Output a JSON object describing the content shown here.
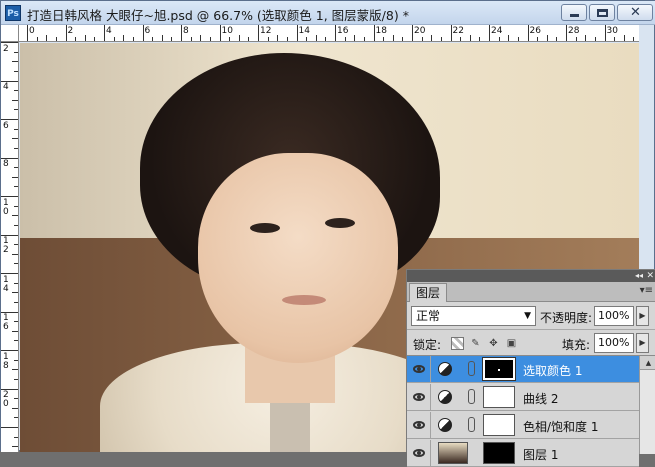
{
  "window": {
    "app_icon": "Ps",
    "title": "打造日韩风格 大眼仔~旭.psd @ 66.7% (选取颜色 1, 图层蒙版/8) *",
    "controls": [
      "minimize-icon",
      "maximize-icon",
      "close-icon"
    ]
  },
  "rulers": {
    "top_labels": [
      "0",
      "2",
      "4",
      "6",
      "8",
      "10",
      "12",
      "14",
      "16",
      "18",
      "20",
      "22",
      "24",
      "26",
      "28",
      "30"
    ],
    "left_labels": [
      "2",
      "4",
      "6",
      "8",
      "1\n0",
      "1\n2",
      "1\n4",
      "1\n6",
      "1\n8",
      "2\n0"
    ]
  },
  "layers_panel": {
    "tab": "图层",
    "blend_mode": "正常",
    "opacity_label": "不透明度:",
    "opacity_value": "100%",
    "lock_label": "锁定:",
    "fill_label": "填充:",
    "fill_value": "100%",
    "layers": [
      {
        "name": "选取颜色 1",
        "type": "adjustment",
        "mask": "black",
        "selected": true,
        "visible": true
      },
      {
        "name": "曲线 2",
        "type": "adjustment",
        "mask": "white",
        "selected": false,
        "visible": true
      },
      {
        "name": "色相/饱和度 1",
        "type": "adjustment",
        "mask": "white",
        "selected": false,
        "visible": true
      },
      {
        "name": "图层 1",
        "type": "pixel",
        "mask": "black",
        "selected": false,
        "visible": true
      }
    ]
  }
}
